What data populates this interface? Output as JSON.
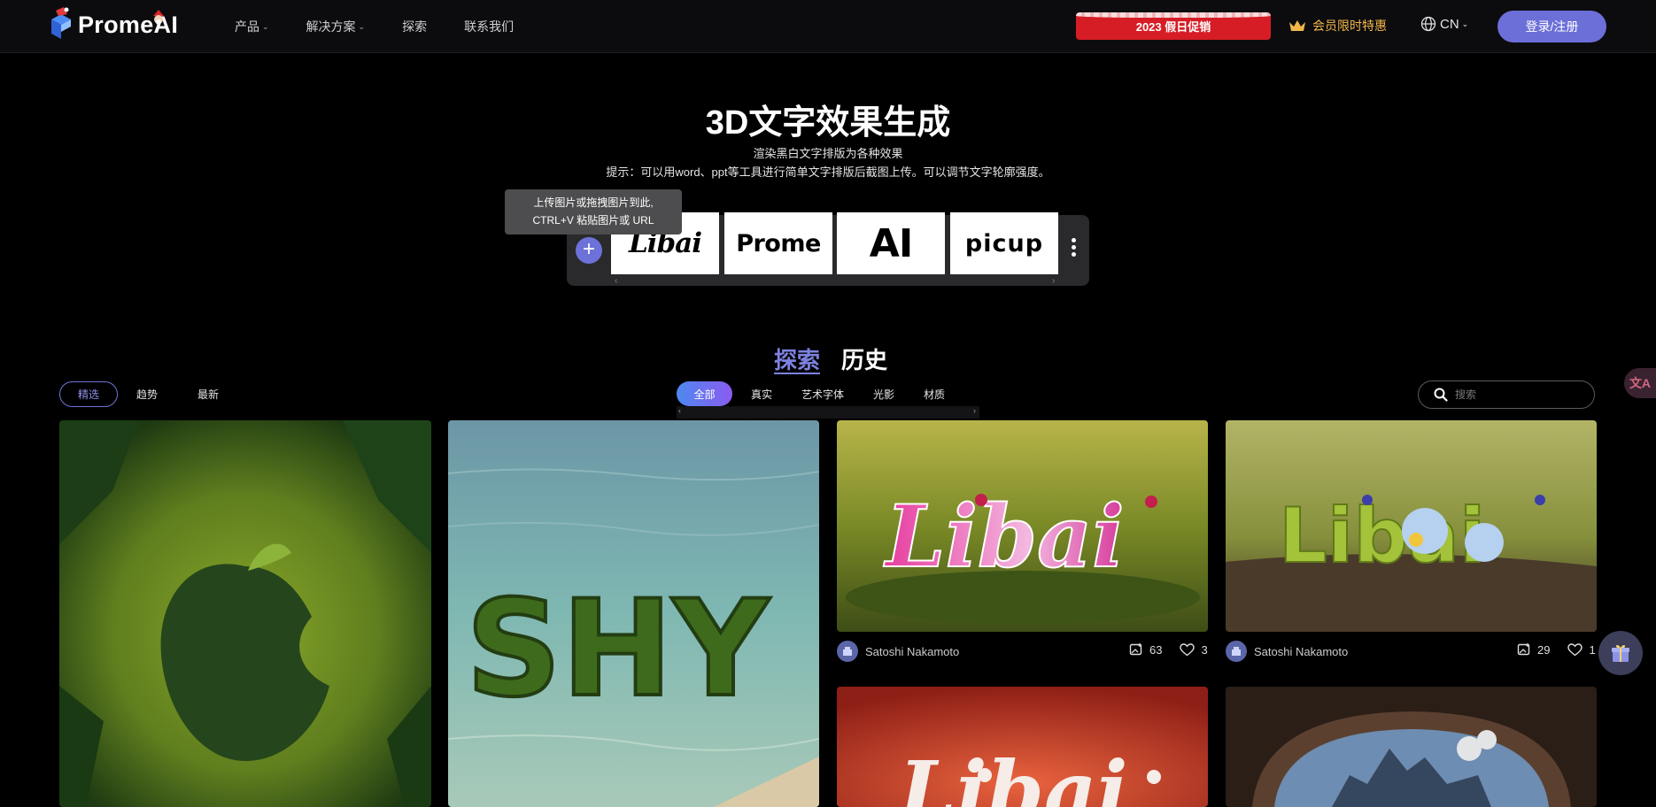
{
  "header": {
    "logo_text": "PromeAI",
    "nav": [
      {
        "label": "产品",
        "has_dropdown": true
      },
      {
        "label": "解决方案",
        "has_dropdown": true
      },
      {
        "label": "探索",
        "has_dropdown": false
      },
      {
        "label": "联系我们",
        "has_dropdown": false
      }
    ],
    "promo_label": "2023 假日促销",
    "vip_label": "会员限时特惠",
    "lang_label": "CN",
    "login_label": "登录/注册",
    "colors": {
      "promo": "#d61d25",
      "vip": "#f3b64b",
      "login": "#6c6fd8"
    }
  },
  "hero": {
    "title": "3D文字效果生成",
    "subtitle": "渲染黑白文字排版为各种效果",
    "tip": "提示：可以用word、ppt等工具进行简单文字排版后截图上传。可以调节文字轮廓强度。"
  },
  "upload": {
    "tooltip_line1": "上传图片或拖拽图片到此,",
    "tooltip_line2": "CTRL+V 粘贴图片或 URL",
    "plus": "+",
    "samples": [
      "Libai",
      "Prome",
      "AI",
      "picup"
    ]
  },
  "tabs": {
    "main": [
      "探索",
      "历史"
    ],
    "sort": [
      "精选",
      "趋势",
      "最新"
    ],
    "categories": [
      "全部",
      "真实",
      "艺术字体",
      "光影",
      "材质"
    ]
  },
  "search": {
    "placeholder": "搜索"
  },
  "cards": [
    {
      "image": "apple-grass-jungle"
    },
    {
      "image": "shy-grass-water"
    },
    {
      "image": "libai-pink-moss",
      "author": "Satoshi Nakamoto",
      "uses": "63",
      "likes": "3"
    },
    {
      "image": "libai-flowers-wood",
      "author": "Satoshi Nakamoto",
      "uses": "29",
      "likes": "1"
    },
    {
      "image": "libai-red-3d"
    },
    {
      "image": "castle-dome"
    }
  ],
  "floating": {
    "translate_label": "文A"
  }
}
